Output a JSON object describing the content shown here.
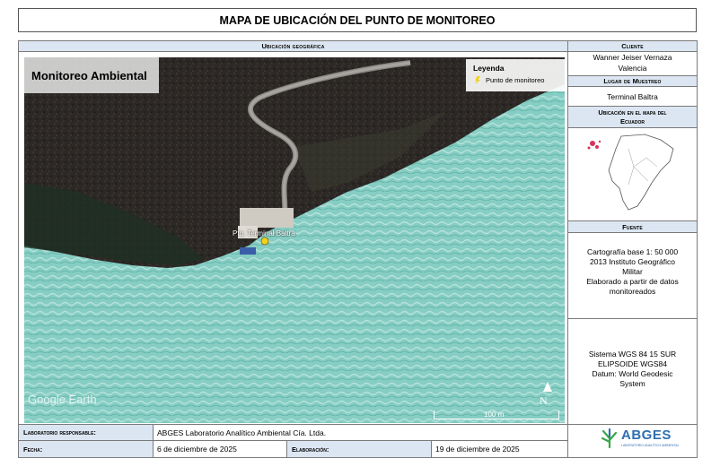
{
  "title": "MAPA DE UBICACIÓN DEL PUNTO DE MONITOREO",
  "map_panel": {
    "header": "Ubicación geográfica",
    "overlay_title": "Monitoreo Ambiental",
    "legend_title": "Leyenda",
    "legend_item": "Punto de monitoreo",
    "point_label": "Pto. Terminal Baltra",
    "watermark": "Google Earth",
    "scale": "100 m",
    "north": "N"
  },
  "sidebar": {
    "cliente_header": "Cliente",
    "cliente_line1": "Wanner Jeiser Vernaza",
    "cliente_line2": "Valencia",
    "lugar_header": "Lugar de Muestreo",
    "lugar_value": "Terminal Baltra",
    "ubicacion_header_line1": "Ubicación en el mapa del",
    "ubicacion_header_line2": "Ecuador",
    "fuente_header": "Fuente",
    "fuente_lines": [
      "Cartografía base 1: 50 000",
      "2013 Instituto Geográfico",
      "Militar",
      "Elaborado a partir de datos",
      "monitoreados"
    ],
    "sistema_lines": [
      "Sistema WGS 84 15 SUR",
      "ELIPSOIDE WGS84",
      "Datum: World Geodesic",
      "System"
    ],
    "logo_text": "ABGES",
    "logo_sub": "LABORATORIO ANALÍTICO AMBIENTAL"
  },
  "footer": {
    "responsable_label": "Laboratorio responsable:",
    "responsable_value": "ABGES Laboratorio Analítico Ambiental Cía. Ltda.",
    "fecha_label": "Fecha:",
    "fecha_value": "6 de diciembre de 2025",
    "elaboracion_label": "Elaboración:",
    "elaboracion_value": "19 de diciembre de 2025"
  },
  "colors": {
    "header_bg": "#dce6f2",
    "sea": "#7fc9bf",
    "land": "#2b2724",
    "logo_green": "#3aa64a",
    "logo_blue": "#2f6fb0",
    "marker": "#f2d21b"
  }
}
